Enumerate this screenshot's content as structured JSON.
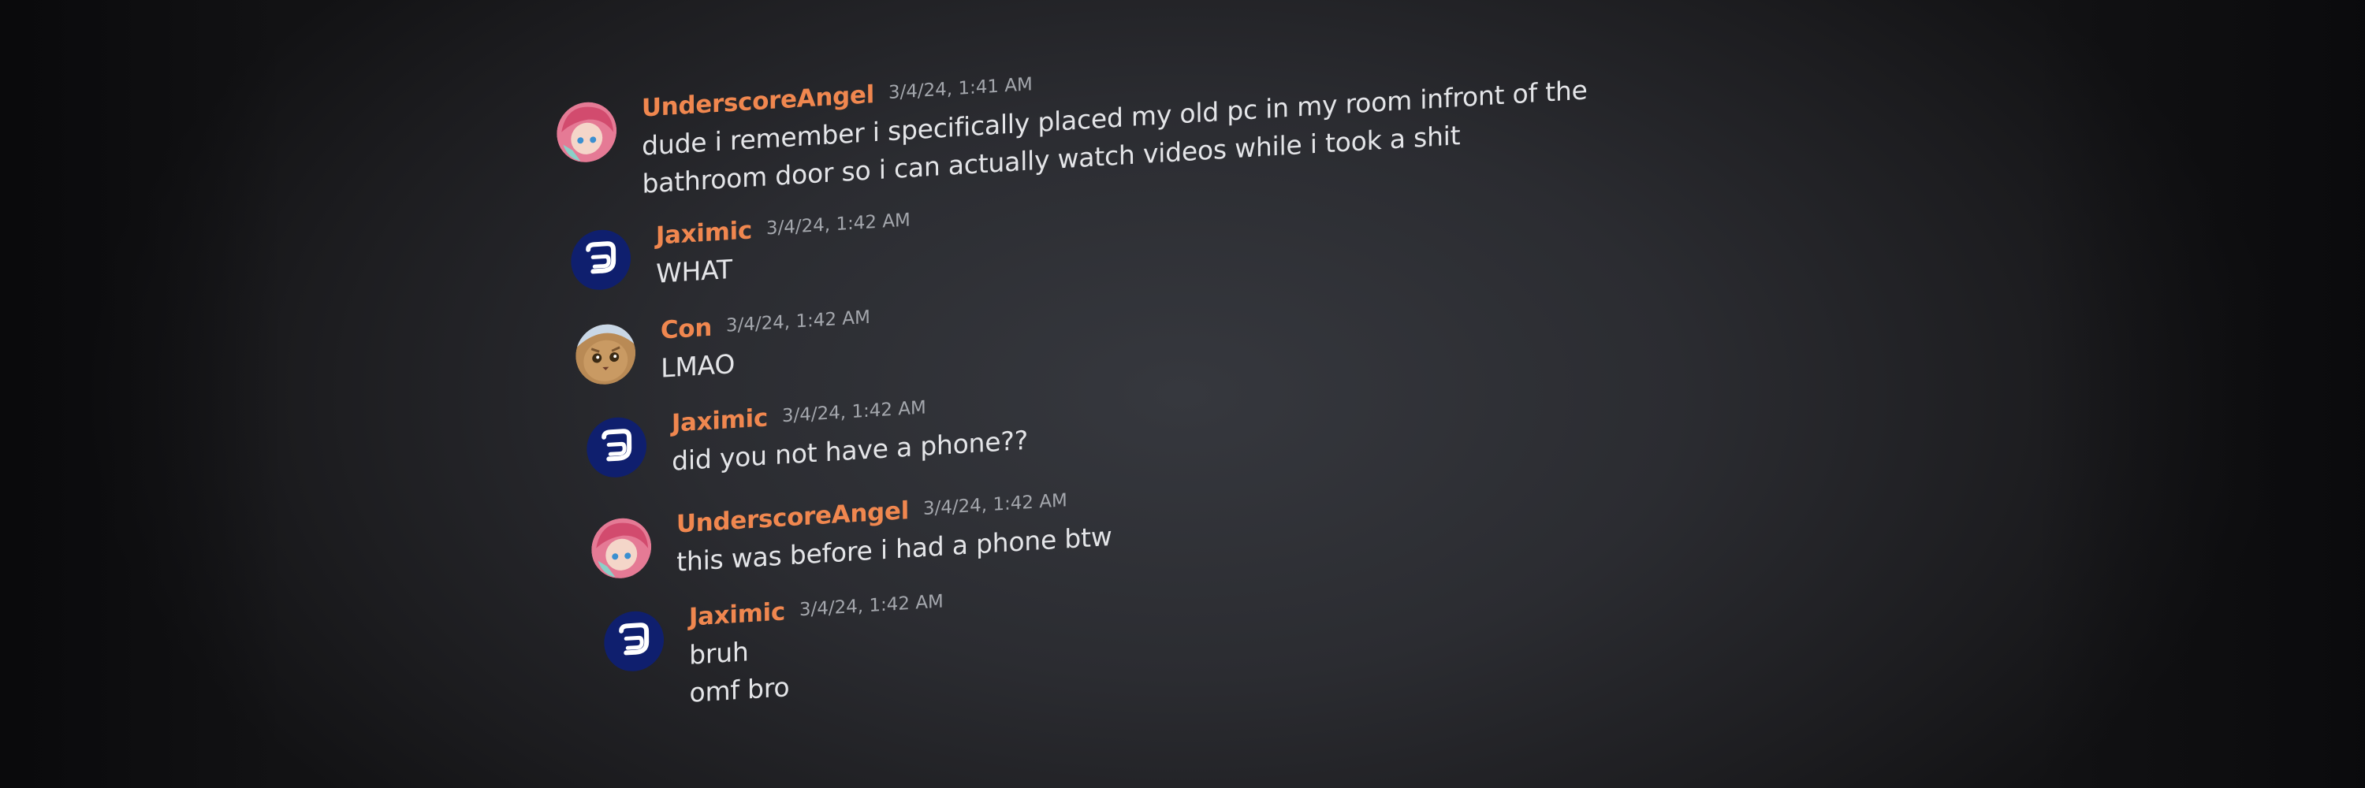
{
  "messages": [
    {
      "author": "UnderscoreAngel",
      "avatar": "anime-pink-hair-avatar-icon",
      "timestamp": "3/4/24, 1:41 AM",
      "lines": [
        "dude i remember i specifically placed my old pc in my room infront of the",
        "bathroom door so i can actually watch videos while i took a shit"
      ]
    },
    {
      "author": "Jaximic",
      "avatar": "jaximic-logo-avatar-icon",
      "timestamp": "3/4/24, 1:42 AM",
      "lines": [
        "WHAT"
      ]
    },
    {
      "author": "Con",
      "avatar": "cat-face-avatar-icon",
      "timestamp": "3/4/24, 1:42 AM",
      "lines": [
        "LMAO"
      ]
    },
    {
      "author": "Jaximic",
      "avatar": "jaximic-logo-avatar-icon",
      "timestamp": "3/4/24, 1:42 AM",
      "lines": [
        "did you not have a phone??"
      ]
    },
    {
      "author": "UnderscoreAngel",
      "avatar": "anime-pink-hair-avatar-icon",
      "timestamp": "3/4/24, 1:42 AM",
      "lines": [
        "this was before i had a phone btw"
      ]
    },
    {
      "author": "Jaximic",
      "avatar": "jaximic-logo-avatar-icon",
      "timestamp": "3/4/24, 1:42 AM",
      "lines": [
        "bruh",
        "omf bro"
      ]
    }
  ],
  "colors": {
    "username": "#f0874f",
    "timestamp": "#a4a7ad",
    "message_text": "#e4e5e8",
    "background": "#2b2c31"
  }
}
